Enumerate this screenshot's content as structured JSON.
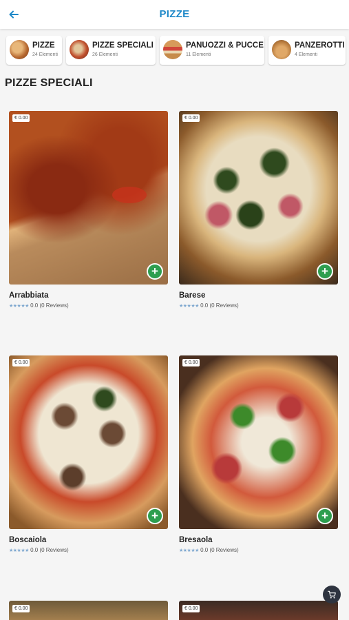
{
  "header": {
    "title": "PIZZE",
    "back_icon": "arrow-left-icon"
  },
  "categories": [
    {
      "label": "PIZZE",
      "count": "24 Elementi",
      "color": "#b5672f"
    },
    {
      "label": "PIZZE SPECIALI",
      "count": "26 Elementi",
      "color": "#c0502e"
    },
    {
      "label": "PANUOZZI & PUCCE",
      "count": "11 Elementi",
      "color": "#c68b4a"
    },
    {
      "label": "PANZEROTTI",
      "count": "4 Elementi",
      "color": "#b77a3c"
    }
  ],
  "section_title": "PIZZE SPECIALI",
  "products": [
    {
      "name": "Arrabbiata",
      "price": "€ 0.00",
      "rating": "0.0 (0 Reviews)",
      "stars": "★★★★★"
    },
    {
      "name": "Barese",
      "price": "€ 0.00",
      "rating": "0.0 (0 Reviews)",
      "stars": "★★★★★"
    },
    {
      "name": "Boscaiola",
      "price": "€ 0.00",
      "rating": "0.0 (0 Reviews)",
      "stars": "★★★★★"
    },
    {
      "name": "Bresaola",
      "price": "€ 0.00",
      "rating": "0.0 (0 Reviews)",
      "stars": "★★★★★"
    }
  ],
  "partial_products": [
    {
      "price": "€ 0.00"
    },
    {
      "price": "€ 0.00"
    }
  ],
  "cart": {
    "icon": "cart-icon"
  },
  "colors": {
    "accent": "#1e88c8",
    "add_button": "#2e9e4f",
    "fab": "#2e3440"
  }
}
